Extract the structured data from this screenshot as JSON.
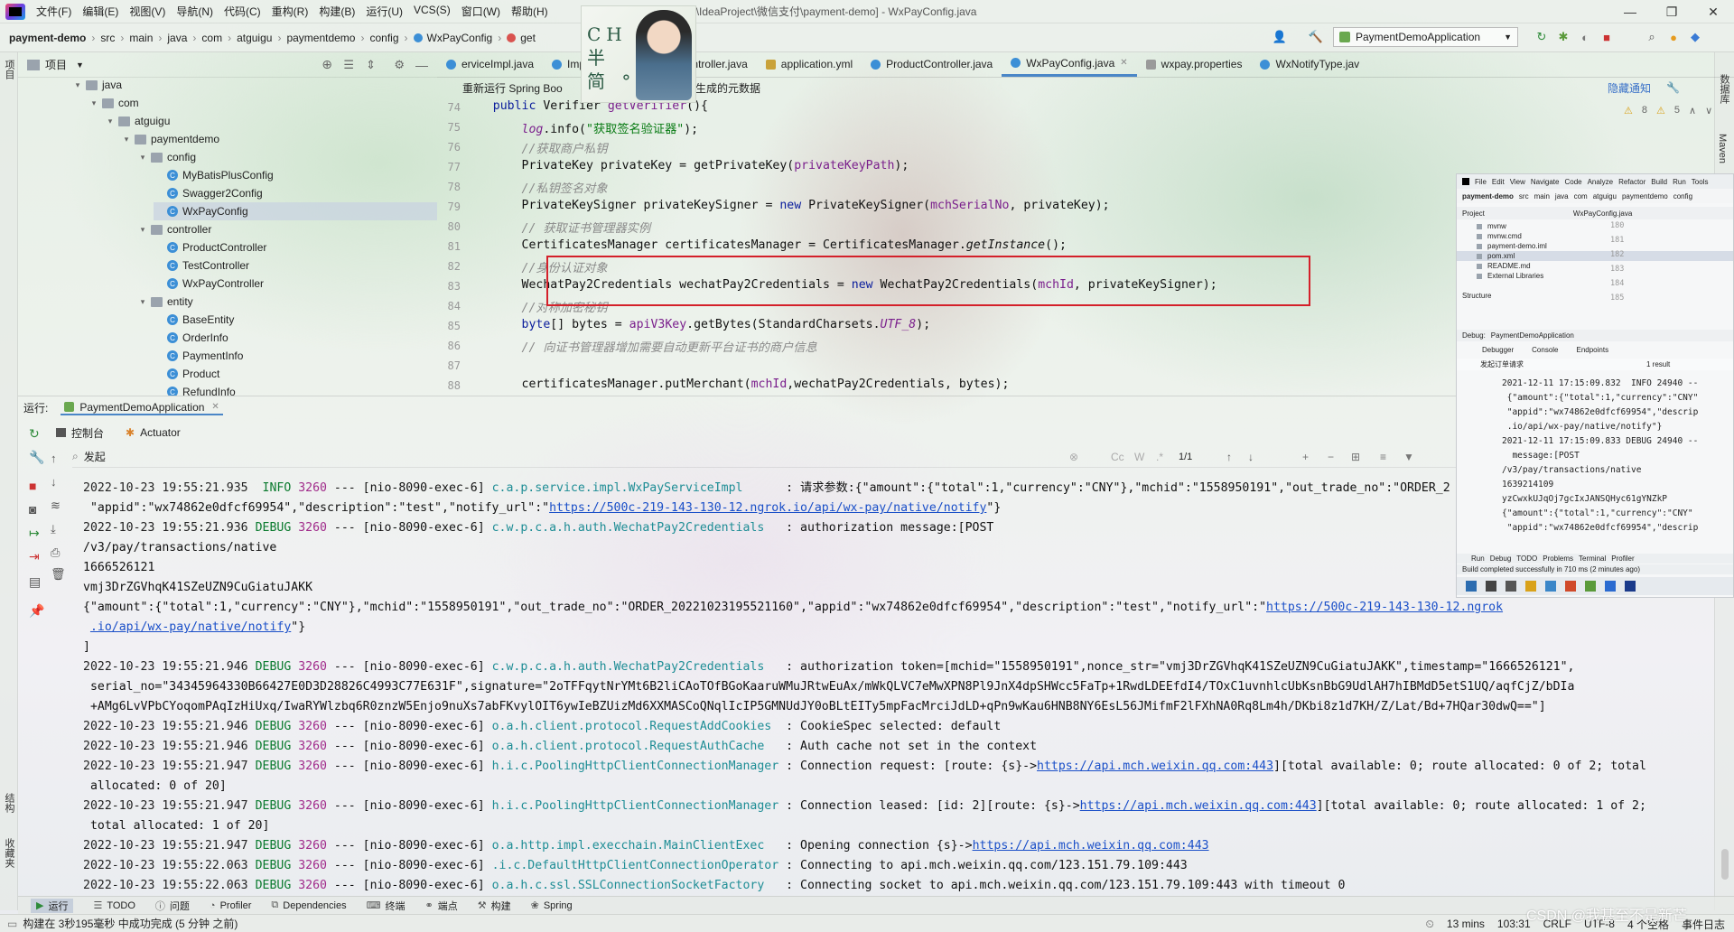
{
  "menubar": {
    "items": [
      "文件(F)",
      "编辑(E)",
      "视图(V)",
      "导航(N)",
      "代码(C)",
      "重构(R)",
      "构建(B)",
      "运行(U)",
      "VCS(S)",
      "窗口(W)",
      "帮助(H)"
    ],
    "window_title": "D:\\IdeaProject\\微信支付\\payment-demo] - WxPayConfig.java"
  },
  "avatar": {
    "text": "CH 半 简 °"
  },
  "navbar": {
    "breadcrumbs": [
      "payment-demo",
      "src",
      "main",
      "java",
      "com",
      "atguigu",
      "paymentdemo",
      "config",
      "WxPayConfig",
      "get"
    ],
    "run_config": "PaymentDemoApplication"
  },
  "project": {
    "title": "项目",
    "nodes": [
      {
        "label": "java",
        "depth": 3,
        "kind": "folder",
        "open": true
      },
      {
        "label": "com",
        "depth": 4,
        "kind": "folder",
        "open": true
      },
      {
        "label": "atguigu",
        "depth": 5,
        "kind": "folder",
        "open": true
      },
      {
        "label": "paymentdemo",
        "depth": 6,
        "kind": "folder",
        "open": true
      },
      {
        "label": "config",
        "depth": 7,
        "kind": "folder",
        "open": true
      },
      {
        "label": "MyBatisPlusConfig",
        "depth": 8,
        "kind": "class"
      },
      {
        "label": "Swagger2Config",
        "depth": 8,
        "kind": "class"
      },
      {
        "label": "WxPayConfig",
        "depth": 8,
        "kind": "class",
        "selected": true
      },
      {
        "label": "controller",
        "depth": 7,
        "kind": "folder",
        "open": true
      },
      {
        "label": "ProductController",
        "depth": 8,
        "kind": "class"
      },
      {
        "label": "TestController",
        "depth": 8,
        "kind": "class"
      },
      {
        "label": "WxPayController",
        "depth": 8,
        "kind": "class"
      },
      {
        "label": "entity",
        "depth": 7,
        "kind": "folder",
        "open": true
      },
      {
        "label": "BaseEntity",
        "depth": 8,
        "kind": "class"
      },
      {
        "label": "OrderInfo",
        "depth": 8,
        "kind": "class"
      },
      {
        "label": "PaymentInfo",
        "depth": 8,
        "kind": "class"
      },
      {
        "label": "Product",
        "depth": 8,
        "kind": "class"
      },
      {
        "label": "RefundInfo",
        "depth": 8,
        "kind": "class"
      }
    ]
  },
  "editor": {
    "tabs": [
      {
        "label": "erviceImpl.java",
        "icon": "class"
      },
      {
        "label": "Impl.java",
        "icon": "class"
      },
      {
        "label": "WxPayController.java",
        "icon": "class"
      },
      {
        "label": "application.yml",
        "icon": "yml"
      },
      {
        "label": "ProductController.java",
        "icon": "class"
      },
      {
        "label": "WxPayConfig.java",
        "icon": "class",
        "active": true
      },
      {
        "label": "wxpay.properties",
        "icon": "props"
      },
      {
        "label": "WxNotifyType.jav",
        "icon": "class"
      }
    ],
    "banner": "重新运行 Spring Boo",
    "banner_tail": "生成的元数据",
    "banner_hide": "隐藏通知",
    "inspections": {
      "warnings": "8",
      "weak": "5"
    },
    "line_numbers": [
      "74",
      "75",
      "76",
      "77",
      "78",
      "79",
      "80",
      "81",
      "82",
      "83",
      "84",
      "85",
      "86",
      "87",
      "88"
    ],
    "lines": [
      [
        [
          "    ",
          ""
        ],
        [
          "public ",
          "kw"
        ],
        [
          "Verifier ",
          ""
        ],
        [
          "getVerifier",
          "fld"
        ],
        [
          "(){",
          ""
        ]
      ],
      [
        [
          "        ",
          ""
        ],
        [
          "log",
          "fld itl"
        ],
        [
          ".info(",
          ""
        ],
        [
          "\"获取签名验证器\"",
          "str"
        ],
        [
          ");",
          ""
        ]
      ],
      [
        [
          "        ",
          ""
        ],
        [
          "//获取商户私钥",
          "cmt"
        ]
      ],
      [
        [
          "        PrivateKey privateKey = getPrivateKey(",
          ""
        ],
        [
          "privateKeyPath",
          "fld"
        ],
        [
          ");",
          ""
        ]
      ],
      [
        [
          "        ",
          ""
        ],
        [
          "//私钥签名对象",
          "cmt"
        ]
      ],
      [
        [
          "        PrivateKeySigner privateKeySigner = ",
          ""
        ],
        [
          "new ",
          "kw"
        ],
        [
          "PrivateKeySigner(",
          ""
        ],
        [
          "mchSerialNo",
          "fld"
        ],
        [
          ", privateKey);",
          ""
        ]
      ],
      [
        [
          "        ",
          ""
        ],
        [
          "// 获取证书管理器实例",
          "cmt"
        ]
      ],
      [
        [
          "        CertificatesManager certificatesManager = CertificatesManager.",
          ""
        ],
        [
          "getInstance",
          "itl"
        ],
        [
          "();",
          ""
        ]
      ],
      [
        [
          "        ",
          ""
        ],
        [
          "//身份认证对象",
          "cmt"
        ]
      ],
      [
        [
          "        WechatPay2Credentials wechatPay2Credentials = ",
          ""
        ],
        [
          "new ",
          "kw"
        ],
        [
          "WechatPay2Credentials(",
          ""
        ],
        [
          "mchId",
          "fld"
        ],
        [
          ", privateKeySigner);",
          ""
        ]
      ],
      [
        [
          "        ",
          ""
        ],
        [
          "//对称加密秘钥",
          "cmt"
        ]
      ],
      [
        [
          "        ",
          ""
        ],
        [
          "byte",
          "kw"
        ],
        [
          "[] bytes = ",
          ""
        ],
        [
          "apiV3Key",
          "fld"
        ],
        [
          ".getBytes(StandardCharsets.",
          ""
        ],
        [
          "UTF_8",
          "fld itl"
        ],
        [
          ");",
          ""
        ]
      ],
      [
        [
          "        ",
          ""
        ],
        [
          "// 向证书管理器增加需要自动更新平台证书的商户信息",
          "cmt"
        ]
      ],
      [
        [
          "",
          ""
        ]
      ],
      [
        [
          "        certificatesManager.putMerchant(",
          ""
        ],
        [
          "mchId",
          "fld"
        ],
        [
          ",wechatPay2Credentials, bytes);",
          ""
        ]
      ]
    ]
  },
  "run": {
    "label": "运行:",
    "app": "PaymentDemoApplication",
    "tabs": [
      "控制台",
      "Actuator"
    ],
    "filter": "发起",
    "match_count": "1/1",
    "logs": [
      [
        [
          "2022-10-23 19:55:21.935  ",
          "ts"
        ],
        [
          "INFO ",
          "info"
        ],
        [
          "3260",
          "pid"
        ],
        [
          " --- [nio-8090-exec-6] ",
          ""
        ],
        [
          "c.a.p.service.impl.WxPayServiceImpl     ",
          "cls"
        ],
        [
          " : 请求参数:{\"amount\":{\"total\":1,\"currency\":\"CNY\"},\"mchid\":\"1558950191\",\"out_trade_no\":\"ORDER_2",
          ""
        ]
      ],
      [
        [
          " \"appid\":\"wx74862e0dfcf69954\",\"description\":\"test\",\"notify_url\":\"",
          ""
        ],
        [
          "https://500c-219-143-130-12.ngrok.io/api/wx-pay/native/notify",
          "url"
        ],
        [
          "\"}",
          ""
        ]
      ],
      [
        [
          "2022-10-23 19:55:21.936 ",
          "ts"
        ],
        [
          "DEBUG ",
          "debug"
        ],
        [
          "3260",
          "pid"
        ],
        [
          " --- [nio-8090-exec-6] ",
          ""
        ],
        [
          "c.w.p.c.a.h.auth.WechatPay2Credentials  ",
          "cls"
        ],
        [
          " : authorization message:[POST",
          ""
        ]
      ],
      [
        [
          "/v3/pay/transactions/native",
          ""
        ]
      ],
      [
        [
          "1666526121",
          ""
        ]
      ],
      [
        [
          "vmj3DrZGVhqK41SZeUZN9CuGiatuJAKK",
          ""
        ]
      ],
      [
        [
          "{\"amount\":{\"total\":1,\"currency\":\"CNY\"},\"mchid\":\"1558950191\",\"out_trade_no\":\"ORDER_20221023195521160\",\"appid\":\"wx74862e0dfcf69954\",\"description\":\"test\",\"notify_url\":\"",
          ""
        ],
        [
          "https://500c-219-143-130-12.ngrok",
          "url"
        ]
      ],
      [
        [
          " ",
          ""
        ],
        [
          ".io/api/wx-pay/native/notify",
          "url"
        ],
        [
          "\"}",
          ""
        ]
      ],
      [
        [
          "]",
          ""
        ]
      ],
      [
        [
          "2022-10-23 19:55:21.946 ",
          "ts"
        ],
        [
          "DEBUG ",
          "debug"
        ],
        [
          "3260",
          "pid"
        ],
        [
          " --- [nio-8090-exec-6] ",
          ""
        ],
        [
          "c.w.p.c.a.h.auth.WechatPay2Credentials  ",
          "cls"
        ],
        [
          " : authorization token=[mchid=\"1558950191\",nonce_str=\"vmj3DrZGVhqK41SZeUZN9CuGiatuJAKK\",timestamp=\"1666526121\",",
          ""
        ]
      ],
      [
        [
          " serial_no=\"34345964330B66427E0D3D28826C4993C77E631F\",signature=\"2oTFFqytNrYMt6B2liCAoTOfBGoKaaruWMuJRtwEuAx/mWkQLVC7eMwXPN8Pl9JnX4dpSHWcc5FaTp+1RwdLDEEfdI4/TOxC1uvnhlcUbKsnBbG9UdlAH7hIBMdD5etS1UQ/aqfCjZ/bDIa",
          ""
        ]
      ],
      [
        [
          " +AMg6LvVPbCYoqomPAqIzHiUxq/IwaRYWlzbq6R0znzW5Enjo9nuXs7abFKvylOIT6ywIeBZUizMd6XXMASCoQNqlIcIP5GMNUdJY0oBLtEITy5mpFacMrciJdLD+qPn9wKau6HNB8NY6EsL56JMifmF2lFXhNA0Rq8Lm4h/DKbi8z1d7KH/Z/Lat/Bd+7HQar30dwQ==\"]",
          ""
        ]
      ],
      [
        [
          "2022-10-23 19:55:21.946 ",
          "ts"
        ],
        [
          "DEBUG ",
          "debug"
        ],
        [
          "3260",
          "pid"
        ],
        [
          " --- [nio-8090-exec-6] ",
          ""
        ],
        [
          "o.a.h.client.protocol.RequestAddCookies ",
          "cls"
        ],
        [
          " : CookieSpec selected: default",
          ""
        ]
      ],
      [
        [
          "2022-10-23 19:55:21.946 ",
          "ts"
        ],
        [
          "DEBUG ",
          "debug"
        ],
        [
          "3260",
          "pid"
        ],
        [
          " --- [nio-8090-exec-6] ",
          ""
        ],
        [
          "o.a.h.client.protocol.RequestAuthCache  ",
          "cls"
        ],
        [
          " : Auth cache not set in the context",
          ""
        ]
      ],
      [
        [
          "2022-10-23 19:55:21.947 ",
          "ts"
        ],
        [
          "DEBUG ",
          "debug"
        ],
        [
          "3260",
          "pid"
        ],
        [
          " --- [nio-8090-exec-6] ",
          ""
        ],
        [
          "h.i.c.PoolingHttpClientConnectionManager",
          "cls"
        ],
        [
          " : Connection request: [route: {s}->",
          ""
        ],
        [
          "https://api.mch.weixin.qq.com:443",
          "url"
        ],
        [
          "][total available: 0; route allocated: 0 of 2; total",
          ""
        ]
      ],
      [
        [
          " allocated: 0 of 20]",
          ""
        ]
      ],
      [
        [
          "2022-10-23 19:55:21.947 ",
          "ts"
        ],
        [
          "DEBUG ",
          "debug"
        ],
        [
          "3260",
          "pid"
        ],
        [
          " --- [nio-8090-exec-6] ",
          ""
        ],
        [
          "h.i.c.PoolingHttpClientConnectionManager",
          "cls"
        ],
        [
          " : Connection leased: [id: 2][route: {s}->",
          ""
        ],
        [
          "https://api.mch.weixin.qq.com:443",
          "url"
        ],
        [
          "][total available: 0; route allocated: 1 of 2;",
          ""
        ]
      ],
      [
        [
          " total allocated: 1 of 20]",
          ""
        ]
      ],
      [
        [
          "2022-10-23 19:55:21.947 ",
          "ts"
        ],
        [
          "DEBUG ",
          "debug"
        ],
        [
          "3260",
          "pid"
        ],
        [
          " --- [nio-8090-exec-6] ",
          ""
        ],
        [
          "o.a.http.impl.execchain.MainClientExec  ",
          "cls"
        ],
        [
          " : Opening connection {s}->",
          ""
        ],
        [
          "https://api.mch.weixin.qq.com:443",
          "url"
        ]
      ],
      [
        [
          "2022-10-23 19:55:22.063 ",
          "ts"
        ],
        [
          "DEBUG ",
          "debug"
        ],
        [
          "3260",
          "pid"
        ],
        [
          " --- [nio-8090-exec-6] ",
          ""
        ],
        [
          ".i.c.DefaultHttpClientConnectionOperator",
          "cls"
        ],
        [
          " : Connecting to api.mch.weixin.qq.com/123.151.79.109:443",
          ""
        ]
      ],
      [
        [
          "2022-10-23 19:55:22.063 ",
          "ts"
        ],
        [
          "DEBUG ",
          "debug"
        ],
        [
          "3260",
          "pid"
        ],
        [
          " --- [nio-8090-exec-6] ",
          ""
        ],
        [
          "o.a.h.c.ssl.SSLConnectionSocketFactory  ",
          "cls"
        ],
        [
          " : Connecting socket to api.mch.weixin.qq.com/123.151.79.109:443 with timeout 0",
          ""
        ]
      ]
    ]
  },
  "bottom_tabs": [
    "运行",
    "TODO",
    "问题",
    "Profiler",
    "Dependencies",
    "终端",
    "端点",
    "构建",
    "Spring"
  ],
  "left_vtabs": [
    "项目",
    "结构",
    "收藏夹"
  ],
  "right_vtabs": [
    "数据库",
    "Maven"
  ],
  "status": {
    "left": "构建在 3秒195毫秒 中成功完成 (5 分钟 之前)",
    "time": "13 mins",
    "pos": "103:31",
    "eol": "CRLF",
    "enc": "UTF-8",
    "indent": "4 个空格",
    "event_log": "事件日志"
  },
  "watermark": "CSDN @我甚至不是新芒",
  "mini": {
    "menu": [
      "File",
      "Edit",
      "View",
      "Navigate",
      "Code",
      "Analyze",
      "Refactor",
      "Build",
      "Run",
      "Tools"
    ],
    "crumbs": [
      "payment-demo",
      "src",
      "main",
      "java",
      "com",
      "atguigu",
      "paymentdemo",
      "config"
    ],
    "project_label": "Project",
    "tab": "WxPayConfig.java",
    "files": [
      "mvnw",
      "mvnw.cmd",
      "payment-demo.iml",
      "pom.xml",
      "README.md",
      "External Libraries"
    ],
    "lines": [
      "180",
      "181",
      "182",
      "183",
      "184",
      "185"
    ],
    "structure": "Structure",
    "debug_label": "Debug:",
    "debug_app": "PaymentDemoApplication",
    "debug_tabs": [
      "Debugger",
      "Console",
      "Endpoints"
    ],
    "search": "发起订单请求",
    "result": "1 result",
    "logs": [
      "2021-12-11 17:15:09.832  INFO 24940 --",
      " {\"amount\":{\"total\":1,\"currency\":\"CNY\"",
      " \"appid\":\"wx74862e0dfcf69954\",\"descrip",
      " .io/api/wx-pay/native/notify\"}",
      "2021-12-11 17:15:09.833 DEBUG 24940 --",
      "  message:[POST",
      "/v3/pay/transactions/native",
      "1639214109",
      "yzCwxkUJqOj7gcIxJANSQHyc61gYNZkP",
      "{\"amount\":{\"total\":1,\"currency\":\"CNY\"",
      " \"appid\":\"wx74862e0dfcf69954\",\"descrip"
    ],
    "bottom": [
      "Run",
      "Debug",
      "TODO",
      "Problems",
      "Terminal",
      "Profiler"
    ],
    "status": "Build completed successfully in 710 ms (2 minutes ago)"
  }
}
